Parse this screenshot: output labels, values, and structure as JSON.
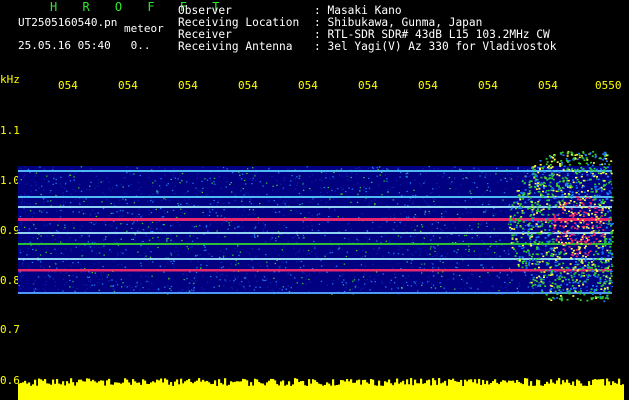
{
  "header": {
    "brand": "H R O F F T",
    "filename": "UT2505160540.pn",
    "tag": "meteor",
    "datetime": "25.05.16 05:40",
    "status": "0.."
  },
  "station": {
    "rows": [
      {
        "label": "Observer",
        "value": ": Masaki Kano"
      },
      {
        "label": "Receiving Location",
        "value": ": Shibukawa, Gunma, Japan"
      },
      {
        "label": "Receiver",
        "value": ": RTL-SDR SDR# 43dB L15 103.2MHz CW"
      },
      {
        "label": "Receiving Antenna",
        "value": ": 3el Yagi(V) Az 330 for Vladivostok"
      }
    ]
  },
  "axis": {
    "unit": "kHz",
    "x_ticks": [
      "054",
      "054",
      "054",
      "054",
      "054",
      "054",
      "054",
      "054",
      "054",
      "0550"
    ],
    "y_ticks": [
      "1.1",
      "1.0",
      "0.9",
      "0.8",
      "0.7",
      "0.6"
    ]
  },
  "colors": {
    "background": "#000000",
    "axis_text": "#ffff00",
    "brand_text": "#2ee82e",
    "info_text": "#ffffff",
    "noise_floor": "#000080",
    "signal_low": "#1e7bff",
    "signal_mid": "#2fd12f",
    "signal_high": "#ff2a6a",
    "power_bar": "#ffff00"
  }
}
